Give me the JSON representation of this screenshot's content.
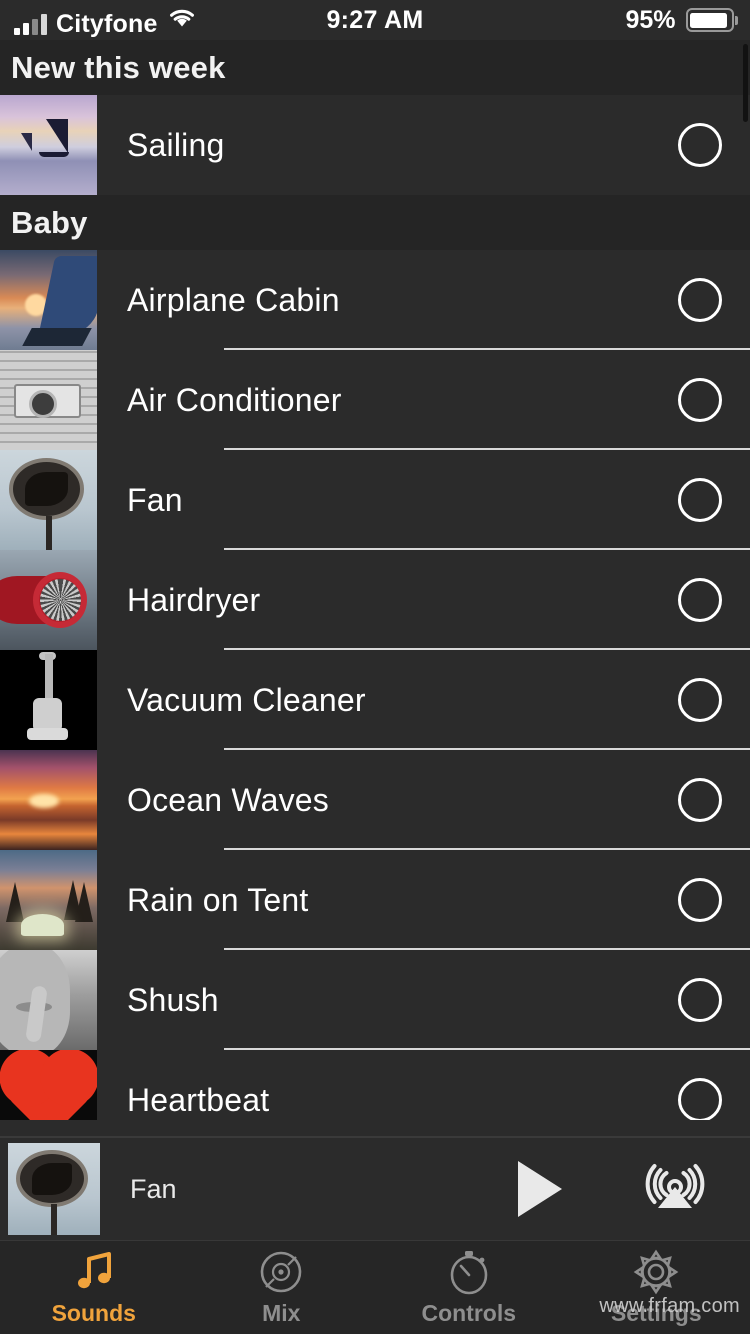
{
  "status_bar": {
    "carrier": "Cityfone",
    "time": "9:27 AM",
    "battery_percent": "95%",
    "signal_icon": "signal-bars-icon",
    "wifi_icon": "wifi-icon",
    "battery_icon": "battery-icon"
  },
  "sections": [
    {
      "title": "New this week",
      "items": [
        {
          "title": "Sailing",
          "art": "art-sailing",
          "selector": "selection-circle"
        }
      ]
    },
    {
      "title": "Baby",
      "items": [
        {
          "title": "Airplane Cabin",
          "art": "art-airplane",
          "selector": "selection-circle"
        },
        {
          "title": "Air Conditioner",
          "art": "art-ac",
          "selector": "selection-circle"
        },
        {
          "title": "Fan",
          "art": "art-fan",
          "selector": "selection-circle"
        },
        {
          "title": "Hairdryer",
          "art": "art-hair",
          "selector": "selection-circle"
        },
        {
          "title": "Vacuum Cleaner",
          "art": "art-vac",
          "selector": "selection-circle"
        },
        {
          "title": "Ocean Waves",
          "art": "art-ocean",
          "selector": "selection-circle"
        },
        {
          "title": "Rain on Tent",
          "art": "art-tent",
          "selector": "selection-circle"
        },
        {
          "title": "Shush",
          "art": "art-shush",
          "selector": "selection-circle"
        },
        {
          "title": "Heartbeat",
          "art": "art-heart",
          "selector": "selection-circle"
        }
      ]
    }
  ],
  "mini_player": {
    "now_playing_title": "Fan",
    "thumbnail_art": "art-fan",
    "play_icon": "play-icon",
    "airplay_icon": "airplay-audio-icon"
  },
  "tab_bar": {
    "active_index": 0,
    "active_color": "#f0a33c",
    "inactive_color": "#8e8e8e",
    "tabs": [
      {
        "label": "Sounds",
        "icon": "music-note-icon"
      },
      {
        "label": "Mix",
        "icon": "vinyl-record-icon"
      },
      {
        "label": "Controls",
        "icon": "stopwatch-icon"
      },
      {
        "label": "Settings",
        "icon": "gear-icon"
      }
    ]
  },
  "watermark": "www.frfam.com",
  "colors": {
    "background": "#2b2b2b",
    "section_header_bg": "#252525",
    "tab_bar_bg": "#262626",
    "separator": "#d9d9d9",
    "text": "#ffffff"
  }
}
